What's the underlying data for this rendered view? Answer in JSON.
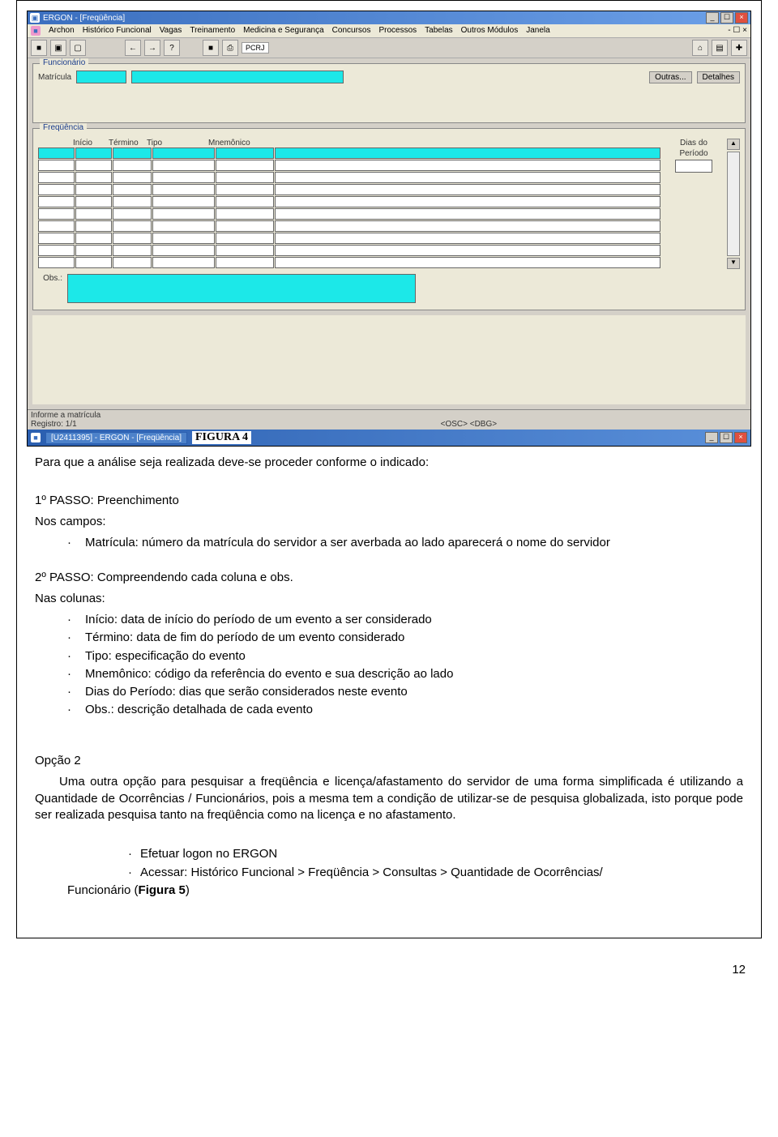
{
  "app": {
    "title1": "ERGON - [Freqüência]",
    "title2_prefix": "[U2411395] - ERGON - [Freqüência]"
  },
  "menubar": [
    "Archon",
    "Histórico Funcional",
    "Vagas",
    "Treinamento",
    "Medicina e Segurança",
    "Concursos",
    "Processos",
    "Tabelas",
    "Outros Módulos",
    "Janela"
  ],
  "mdi_ctrls": "- ☐ ×",
  "toolbar": {
    "glyphs": [
      "■",
      "▣",
      "▢",
      "←",
      "→",
      "?",
      "■",
      "⎙",
      "PCRJ",
      "⌂",
      "▤",
      "✚"
    ]
  },
  "panel_funcionario": {
    "legend": "Funcionário",
    "matricula_label": "Matrícula",
    "btn_outras": "Outras...",
    "btn_detalhes": "Detalhes"
  },
  "panel_freq": {
    "legend": "Freqüência",
    "headers": [
      "Início",
      "Término",
      "Tipo",
      "Mnemônico"
    ],
    "dias_label1": "Dias do",
    "dias_label2": "Período",
    "obs_label": "Obs.:"
  },
  "statusbar": {
    "line1": "Informe a matrícula",
    "line2_left": "Registro: 1/1",
    "line2_right": "<OSC> <DBG>"
  },
  "taskbar_item": "[U2411395] - ERGON - [Freqüência]",
  "figura_caption": "FIGURA 4",
  "body": {
    "p1": "Para que a análise seja realizada deve-se proceder conforme o indicado:",
    "passo1_title": "1º PASSO: Preenchimento",
    "passo1_sub": "Nos campos:",
    "passo1_item1": "Matrícula: número da matrícula do servidor a ser averbada ao lado aparecerá o nome do servidor",
    "passo2_title": "2º PASSO: Compreendendo cada coluna e obs.",
    "passo2_sub": "Nas colunas:",
    "passo2_items": [
      "Início: data de início do período de um evento a ser considerado",
      "Término: data de fim do período de um evento considerado",
      "Tipo: especificação do evento",
      "Mnemônico: código da referência do evento e sua descrição ao lado",
      "Dias do Período: dias que serão considerados neste evento",
      "Obs.: descrição detalhada de cada evento"
    ],
    "opcao2_title": "Opção 2",
    "opcao2_para": "Uma outra opção para pesquisar a freqüência e licença/afastamento do servidor de uma forma simplificada é utilizando a Quantidade de Ocorrências / Funcionários, pois a mesma tem a condição de utilizar-se de pesquisa globalizada, isto porque pode ser realizada pesquisa tanto na freqüência como na licença e no afastamento.",
    "steps": [
      "Efetuar logon no ERGON",
      "Acessar: Histórico Funcional > Freqüência > Consultas > Quantidade de Ocorrências/"
    ],
    "steps_cont": "Funcionário (",
    "steps_fig": "Figura 5",
    "steps_close": ")"
  },
  "page_number": "12"
}
